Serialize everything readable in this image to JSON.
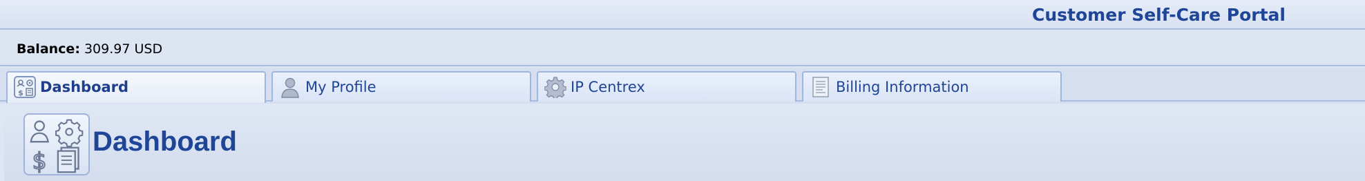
{
  "header": {
    "portal_title": "Customer Self-Care Portal"
  },
  "balance": {
    "label": "Balance:",
    "value": "309.97 USD"
  },
  "tabs": [
    {
      "label": "Dashboard",
      "icon": "dashboard-icon",
      "active": true
    },
    {
      "label": "My Profile",
      "icon": "user-profile-icon",
      "active": false
    },
    {
      "label": "IP Centrex",
      "icon": "gear-icon",
      "active": false
    },
    {
      "label": "Billing Information",
      "icon": "billing-document-icon",
      "active": false
    }
  ],
  "main": {
    "page_title": "Dashboard",
    "title_icon": "dashboard-large-icon"
  },
  "colors": {
    "brand_blue": "#1f4597",
    "tab_border": "#9fb6df",
    "background": "#dfe6f3"
  }
}
